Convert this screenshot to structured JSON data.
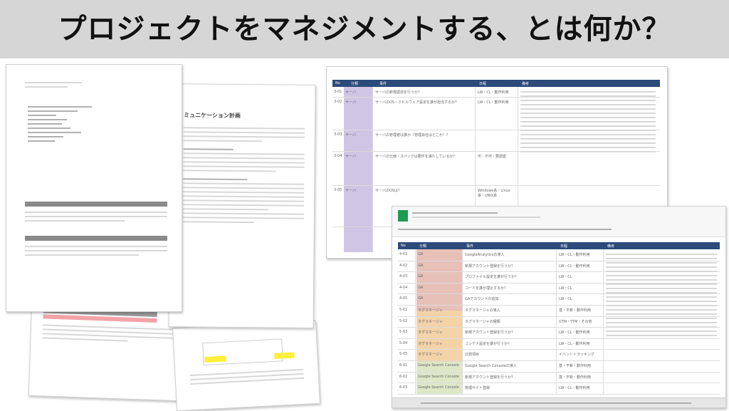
{
  "slide": {
    "title": "プロジェクトをマネジメントする、とは何か？"
  },
  "documents": {
    "communication_plan": {
      "heading": "ミュニケーション計画"
    },
    "spreadsheet_front": {
      "columns": [
        "No",
        "分類",
        "事件",
        "日程",
        "備考"
      ],
      "rows": [
        {
          "no": "4-01",
          "category": "GA",
          "item": "GoogleAnalyticsの導入",
          "schedule": "LW・CL・動作利用"
        },
        {
          "no": "4-02",
          "category": "GA",
          "item": "新規アカウント登録を行うか？",
          "schedule": "LW・CL・動作利用"
        },
        {
          "no": "4-03",
          "category": "GA",
          "item": "プロファイル設定を誰が行うか？",
          "schedule": "LW・CL"
        },
        {
          "no": "4-04",
          "category": "GA",
          "item": "コードを誰が埋込するか？",
          "schedule": "LW・CL"
        },
        {
          "no": "4-05",
          "category": "GA",
          "item": "GAアカウントの追加",
          "schedule": "LW・CL"
        },
        {
          "no": "5-01",
          "category": "タグマネージャ",
          "item": "タグマネージャの導入",
          "schedule": "基・不新・動作利用"
        },
        {
          "no": "5-02",
          "category": "タグマネージャ",
          "item": "タグマネージャの種類",
          "schedule": "GTM・YTM・その他"
        },
        {
          "no": "5-03",
          "category": "タグマネージャ",
          "item": "新規アカウント登録を行うか？",
          "schedule": "LW・CL・動作利用"
        },
        {
          "no": "5-04",
          "category": "タグマネージャ",
          "item": "コンテナ設定を誰が行うか？",
          "schedule": "LW・CL・動作利用"
        },
        {
          "no": "5-05",
          "category": "タグマネージャ",
          "item": "計測項目",
          "schedule": "イベントトラッキング"
        },
        {
          "no": "6-01",
          "category": "Google Search Console",
          "item": "Google Search Consoleの導入",
          "schedule": "基・不新・動作利用"
        },
        {
          "no": "6-02",
          "category": "Google Search Console",
          "item": "新規アカウント登録を行うか？",
          "schedule": "基・不新・動作利用"
        },
        {
          "no": "6-03",
          "category": "Google Search Console",
          "item": "管理サイト登録",
          "schedule": "LW・CL・動作利用"
        }
      ]
    },
    "spreadsheet_back": {
      "columns": [
        "No",
        "分類",
        "事件",
        "日程",
        "備考"
      ],
      "rows": [
        {
          "no": "3-01",
          "category": "サーバ",
          "item": "サーバの新規調達を行うか？",
          "schedule": "LW・CL・動作利用"
        },
        {
          "no": "3-02",
          "category": "サーバ",
          "item": "サーバのOS・ミドルウェア設定を誰が担当するか？",
          "schedule": "LW・CL・動作利用"
        },
        {
          "no": "3-03",
          "category": "サーバ",
          "item": "サーバの管理者は誰か（管理会社はどこか）？",
          "schedule": ""
        },
        {
          "no": "3-04",
          "category": "サーバ",
          "item": "サーバの仕様・スペックは要件を満たしているか？",
          "schedule": "可・不可・要調査"
        },
        {
          "no": "3-05",
          "category": "サーバ",
          "item": "サーバのOSは？",
          "schedule": "Windows系・Linux系・UNIX系"
        }
      ]
    }
  }
}
